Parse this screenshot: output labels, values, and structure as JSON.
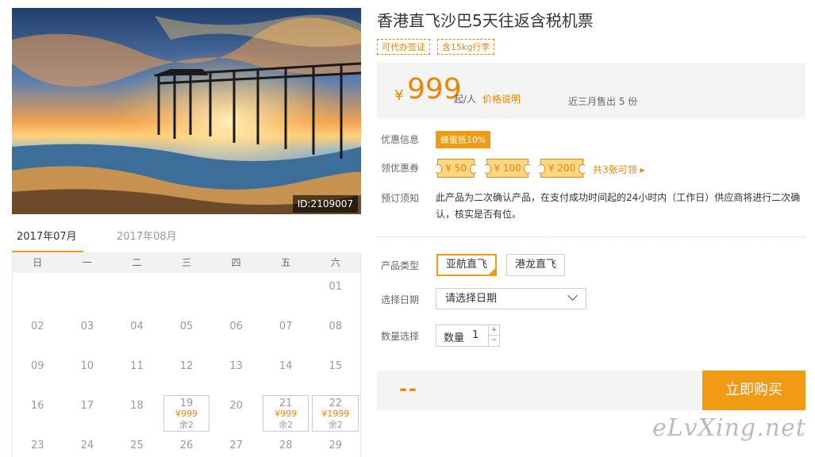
{
  "product": {
    "title": "香港直飞沙巴5天往返含税机票",
    "tags": [
      "可代办签证",
      "含15kg行李"
    ],
    "photo_id": "ID:2109007"
  },
  "price": {
    "currency": "¥",
    "amount": "999",
    "unit": "起/人",
    "note": "价格说明",
    "sold": "近三月售出 5 份"
  },
  "promo": {
    "label": "优惠信息",
    "badge": "蜂蜜抵10%"
  },
  "coupons": {
    "label": "领优惠券",
    "items": [
      "¥ 50",
      "¥ 100",
      "¥ 200"
    ],
    "more": "共3张可领 ▸"
  },
  "notice": {
    "label": "预订须知",
    "text": "此产品为二次确认产品，在支付成功时间起的24小时内（工作日）供应商将进行二次确认，核实是否有位。"
  },
  "options": {
    "type_label": "产品类型",
    "types": [
      "亚航直飞",
      "港龙直飞"
    ],
    "date_label": "选择日期",
    "date_placeholder": "请选择日期",
    "qty_label": "数量选择",
    "qty_inner_label": "数量",
    "qty_value": "1",
    "plus": "+",
    "minus": "−"
  },
  "buy": {
    "total": "--",
    "button": "立即购买"
  },
  "calendar": {
    "months": [
      "2017年07月",
      "2017年08月"
    ],
    "weekdays": [
      "日",
      "一",
      "二",
      "三",
      "四",
      "五",
      "六"
    ],
    "rows": [
      [
        {
          "d": ""
        },
        {
          "d": ""
        },
        {
          "d": ""
        },
        {
          "d": ""
        },
        {
          "d": ""
        },
        {
          "d": ""
        },
        {
          "d": "01"
        }
      ],
      [
        {
          "d": "02"
        },
        {
          "d": "03"
        },
        {
          "d": "04"
        },
        {
          "d": "05"
        },
        {
          "d": "06"
        },
        {
          "d": "07"
        },
        {
          "d": "08"
        }
      ],
      [
        {
          "d": "09"
        },
        {
          "d": "10"
        },
        {
          "d": "11"
        },
        {
          "d": "12"
        },
        {
          "d": "13"
        },
        {
          "d": "14"
        },
        {
          "d": "15"
        }
      ],
      [
        {
          "d": "16"
        },
        {
          "d": "17"
        },
        {
          "d": "18"
        },
        {
          "d": "19",
          "price": "¥999",
          "stock": "余2"
        },
        {
          "d": "20"
        },
        {
          "d": "21",
          "price": "¥999",
          "stock": "余2"
        },
        {
          "d": "22",
          "price": "¥1999",
          "stock": "余2"
        }
      ],
      [
        {
          "d": "23"
        },
        {
          "d": "24"
        },
        {
          "d": "25"
        },
        {
          "d": "26"
        },
        {
          "d": "27"
        },
        {
          "d": "28"
        },
        {
          "d": "29"
        }
      ]
    ]
  },
  "watermark": "eLvXing.net",
  "colors": {
    "accent": "#f19b14",
    "accent_text": "#f08300",
    "coupon_fill": "#fcd886",
    "panel_bg": "#f4f4f4"
  }
}
